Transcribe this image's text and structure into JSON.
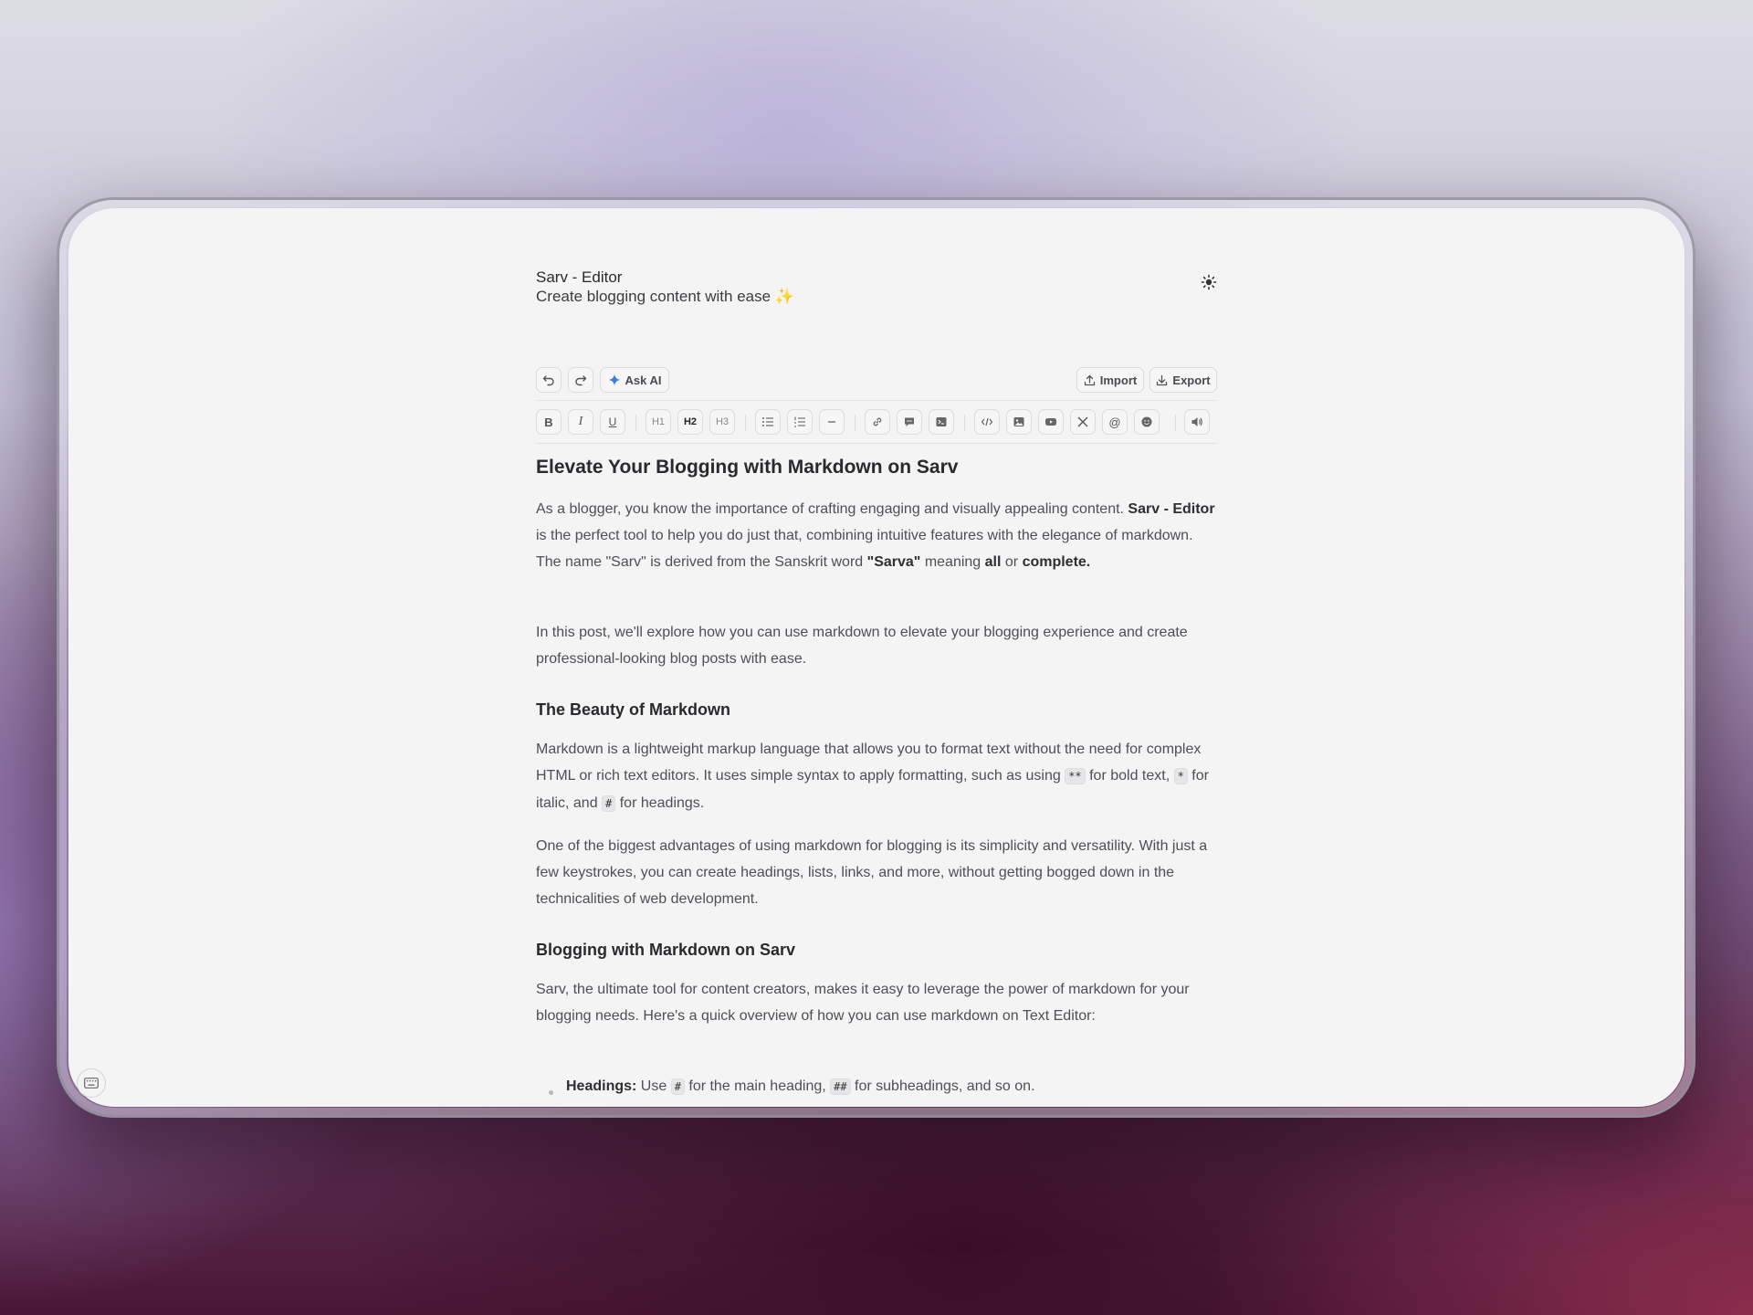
{
  "app": {
    "title": "Sarv - Editor",
    "subtitle": "Create blogging content with ease ✨"
  },
  "toolbar": {
    "ask_ai_label": "Ask AI",
    "import_label": "Import",
    "export_label": "Export"
  },
  "format_bar": {
    "h1": "H1",
    "h2": "H2",
    "h3": "H3"
  },
  "document": {
    "title": "Elevate Your Blogging with Markdown on Sarv",
    "p1_a": "As a blogger, you know the importance of crafting engaging and visually appealing content. ",
    "p1_b": "Sarv - Editor",
    "p1_c": " is the perfect tool to help you do just that, combining intuitive features with the elegance of markdown. The name \"Sarv\"  is derived from the Sanskrit word  ",
    "p1_d": "\"Sarva\"",
    "p1_e": " meaning ",
    "p1_f": "all",
    "p1_g": " or ",
    "p1_h": "complete.",
    "p2": "In this post, we'll explore how you can use markdown to elevate your blogging experience and create professional-looking blog posts with ease.",
    "h_beauty": "The Beauty of Markdown",
    "p3_a": "Markdown is a lightweight markup language that allows you to format text without the need for complex HTML or rich text editors. It uses simple syntax to apply formatting, such as using ",
    "p3_code1": "**",
    "p3_b": " for bold text, ",
    "p3_code2": "*",
    "p3_c": " for italic, and ",
    "p3_code3": "#",
    "p3_d": " for headings.",
    "p4": "One of the biggest advantages of using markdown for blogging is its simplicity and versatility. With just a few keystrokes, you can create headings, lists, links, and more, without getting bogged down in the technicalities of web development.",
    "h_blogging": "Blogging with Markdown on Sarv",
    "p5": "Sarv, the ultimate tool for content creators, makes it easy to leverage the power of markdown for your blogging needs. Here's a quick overview of how you can use markdown on Text Editor:",
    "li1_label": "Headings:",
    "li1_a": " Use ",
    "li1_code1": "#",
    "li1_b": " for the main heading, ",
    "li1_code2": "##",
    "li1_c": " for subheadings, and so on."
  },
  "colors": {
    "accent_ai": "#3d7be0",
    "screen_bg": "#f4f4f4",
    "text": "#4d4f56"
  }
}
